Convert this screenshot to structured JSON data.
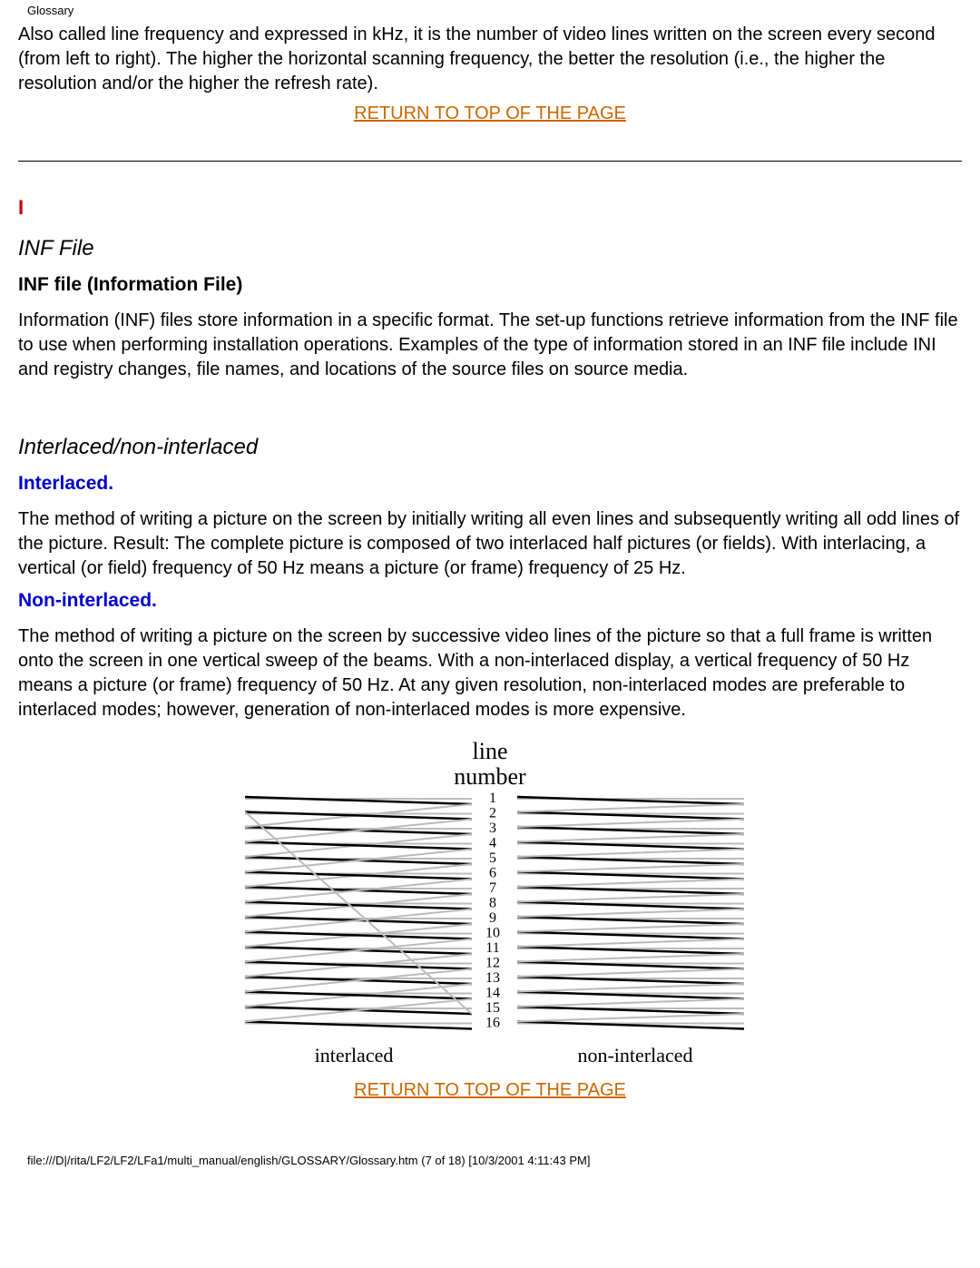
{
  "header": {
    "title": "Glossary"
  },
  "intro": {
    "para": "Also called line frequency and expressed in kHz, it is the number of video lines written on the screen every second (from left to right). The higher the horizontal scanning frequency, the better the resolution (i.e., the higher the resolution and/or the higher the refresh rate)."
  },
  "links": {
    "return_top": "RETURN TO TOP OF THE PAGE"
  },
  "section_letter": "I",
  "inf": {
    "title": "INF File",
    "sub": "INF file (Information File)",
    "para": "Information (INF) files store information in a specific format. The set-up functions retrieve information from the INF file to use when performing installation operations. Examples of the type of information stored in an INF file include INI and registry changes, file names, and locations of the source files on source media."
  },
  "interlaced": {
    "title": "Interlaced/non-interlaced",
    "label1": "Interlaced.",
    "para1": "The method of writing a picture on the screen by initially writing all even lines and subsequently writing all odd lines of the picture. Result: The complete picture is composed of two interlaced half pictures (or fields). With interlacing, a vertical (or field) frequency of 50 Hz means a picture (or frame) frequency of 25 Hz.",
    "label2": "Non-interlaced.",
    "para2": "The method of writing a picture on the screen by successive video lines of the picture so that a full frame is written onto the screen in one vertical sweep of the beams. With a non-interlaced display, a vertical frequency of 50 Hz means a picture (or frame) frequency of 50 Hz. At any given resolution, non-interlaced modes are preferable to interlaced modes; however, generation of non-interlaced modes is more expensive."
  },
  "diagram": {
    "center_title_top": "line",
    "center_title_bottom": "number",
    "left_caption": "interlaced",
    "right_caption": "non-interlaced",
    "line_numbers": [
      "1",
      "2",
      "3",
      "4",
      "5",
      "6",
      "7",
      "8",
      "9",
      "10",
      "11",
      "12",
      "13",
      "14",
      "15",
      "16"
    ]
  },
  "footer": {
    "path": "file:///D|/rita/LF2/LF2/LFa1/multi_manual/english/GLOSSARY/Glossary.htm (7 of 18) [10/3/2001 4:11:43 PM]"
  }
}
